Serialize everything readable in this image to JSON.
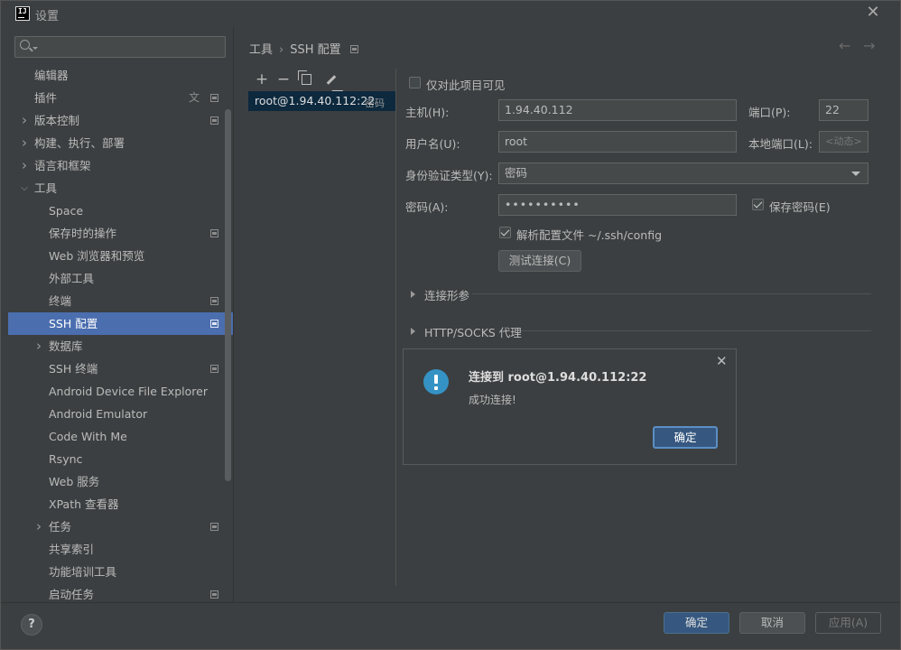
{
  "window": {
    "title": "设置"
  },
  "search": {
    "placeholder": ""
  },
  "sidebar": {
    "items": [
      {
        "label": "编辑器",
        "expandable": false,
        "indent": 0,
        "badge": false
      },
      {
        "label": "插件",
        "expandable": false,
        "indent": 0,
        "badge": true,
        "translate_icon": true
      },
      {
        "label": "版本控制",
        "expandable": true,
        "indent": 0,
        "badge": true
      },
      {
        "label": "构建、执行、部署",
        "expandable": true,
        "indent": 0,
        "badge": false
      },
      {
        "label": "语言和框架",
        "expandable": true,
        "indent": 0,
        "badge": false
      },
      {
        "label": "工具",
        "expandable": true,
        "expanded": true,
        "indent": 0,
        "badge": false
      },
      {
        "label": "Space",
        "indent": 1,
        "badge": false
      },
      {
        "label": "保存时的操作",
        "indent": 1,
        "badge": true
      },
      {
        "label": "Web 浏览器和预览",
        "indent": 1,
        "badge": false
      },
      {
        "label": "外部工具",
        "indent": 1,
        "badge": false
      },
      {
        "label": "终端",
        "indent": 1,
        "badge": true
      },
      {
        "label": "SSH 配置",
        "indent": 1,
        "badge": true,
        "selected": true
      },
      {
        "label": "数据库",
        "expandable": true,
        "indent": 1,
        "badge": false
      },
      {
        "label": "SSH 终端",
        "indent": 1,
        "badge": true
      },
      {
        "label": "Android Device File Explorer",
        "indent": 1,
        "badge": false
      },
      {
        "label": "Android Emulator",
        "indent": 1,
        "badge": false
      },
      {
        "label": "Code With Me",
        "indent": 1,
        "badge": false
      },
      {
        "label": "Rsync",
        "indent": 1,
        "badge": false
      },
      {
        "label": "Web 服务",
        "indent": 1,
        "badge": false
      },
      {
        "label": "XPath 查看器",
        "indent": 1,
        "badge": false
      },
      {
        "label": "任务",
        "expandable": true,
        "indent": 1,
        "badge": true
      },
      {
        "label": "共享索引",
        "indent": 1,
        "badge": false
      },
      {
        "label": "功能培训工具",
        "indent": 1,
        "badge": false
      },
      {
        "label": "启动任务",
        "indent": 1,
        "badge": true
      }
    ]
  },
  "breadcrumb": {
    "parent": "工具",
    "separator": "›",
    "current": "SSH 配置"
  },
  "hosts": {
    "toolbar": {
      "add": "+",
      "remove": "−"
    },
    "entries": [
      {
        "name": "root@1.94.40.112:22",
        "auth": "密码"
      }
    ]
  },
  "form": {
    "project_only_label": "仅对此项目可见",
    "host_label": "主机(H):",
    "host_value": "1.94.40.112",
    "port_label": "端口(P):",
    "port_value": "22",
    "username_label": "用户名(U):",
    "username_value": "root",
    "local_port_label": "本地端口(L):",
    "local_port_value": "<动态>",
    "auth_type_label": "身份验证类型(Y):",
    "auth_type_value": "密码",
    "password_label": "密码(A):",
    "password_value": "••••••••••",
    "save_password_label": "保存密码(E)",
    "parse_config_label": "解析配置文件 ~/.ssh/config",
    "test_button": "测试连接(C)",
    "section_params": "连接形参",
    "section_proxy": "HTTP/SOCKS 代理"
  },
  "popup": {
    "title": "连接到 root@1.94.40.112:22",
    "message": "成功连接!",
    "ok": "确定"
  },
  "footer": {
    "help": "?",
    "ok": "确定",
    "cancel": "取消",
    "apply": "应用(A)"
  },
  "colors": {
    "selection": "#4b6eaf",
    "primary_button": "#365880",
    "info_icon": "#3592c4"
  }
}
